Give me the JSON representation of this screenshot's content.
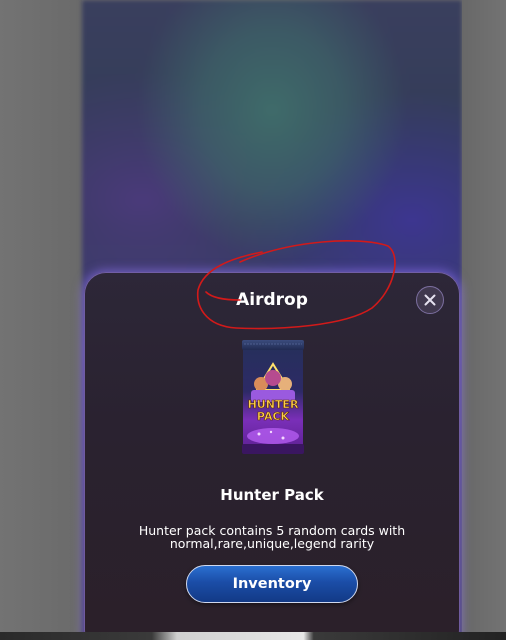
{
  "modal": {
    "title": "Airdrop",
    "close_icon": "close-icon",
    "item": {
      "name": "Hunter Pack",
      "description": "Hunter pack contains 5 random cards with normal,rare,unique,legend rarity",
      "pack_art_text": [
        "HUNTER",
        "PACK"
      ]
    },
    "primary_button_label": "Inventory"
  },
  "colors": {
    "modal_border": "#9c85ff",
    "button_blue": "#1b4da7",
    "annotation_red": "#d21a1a"
  }
}
